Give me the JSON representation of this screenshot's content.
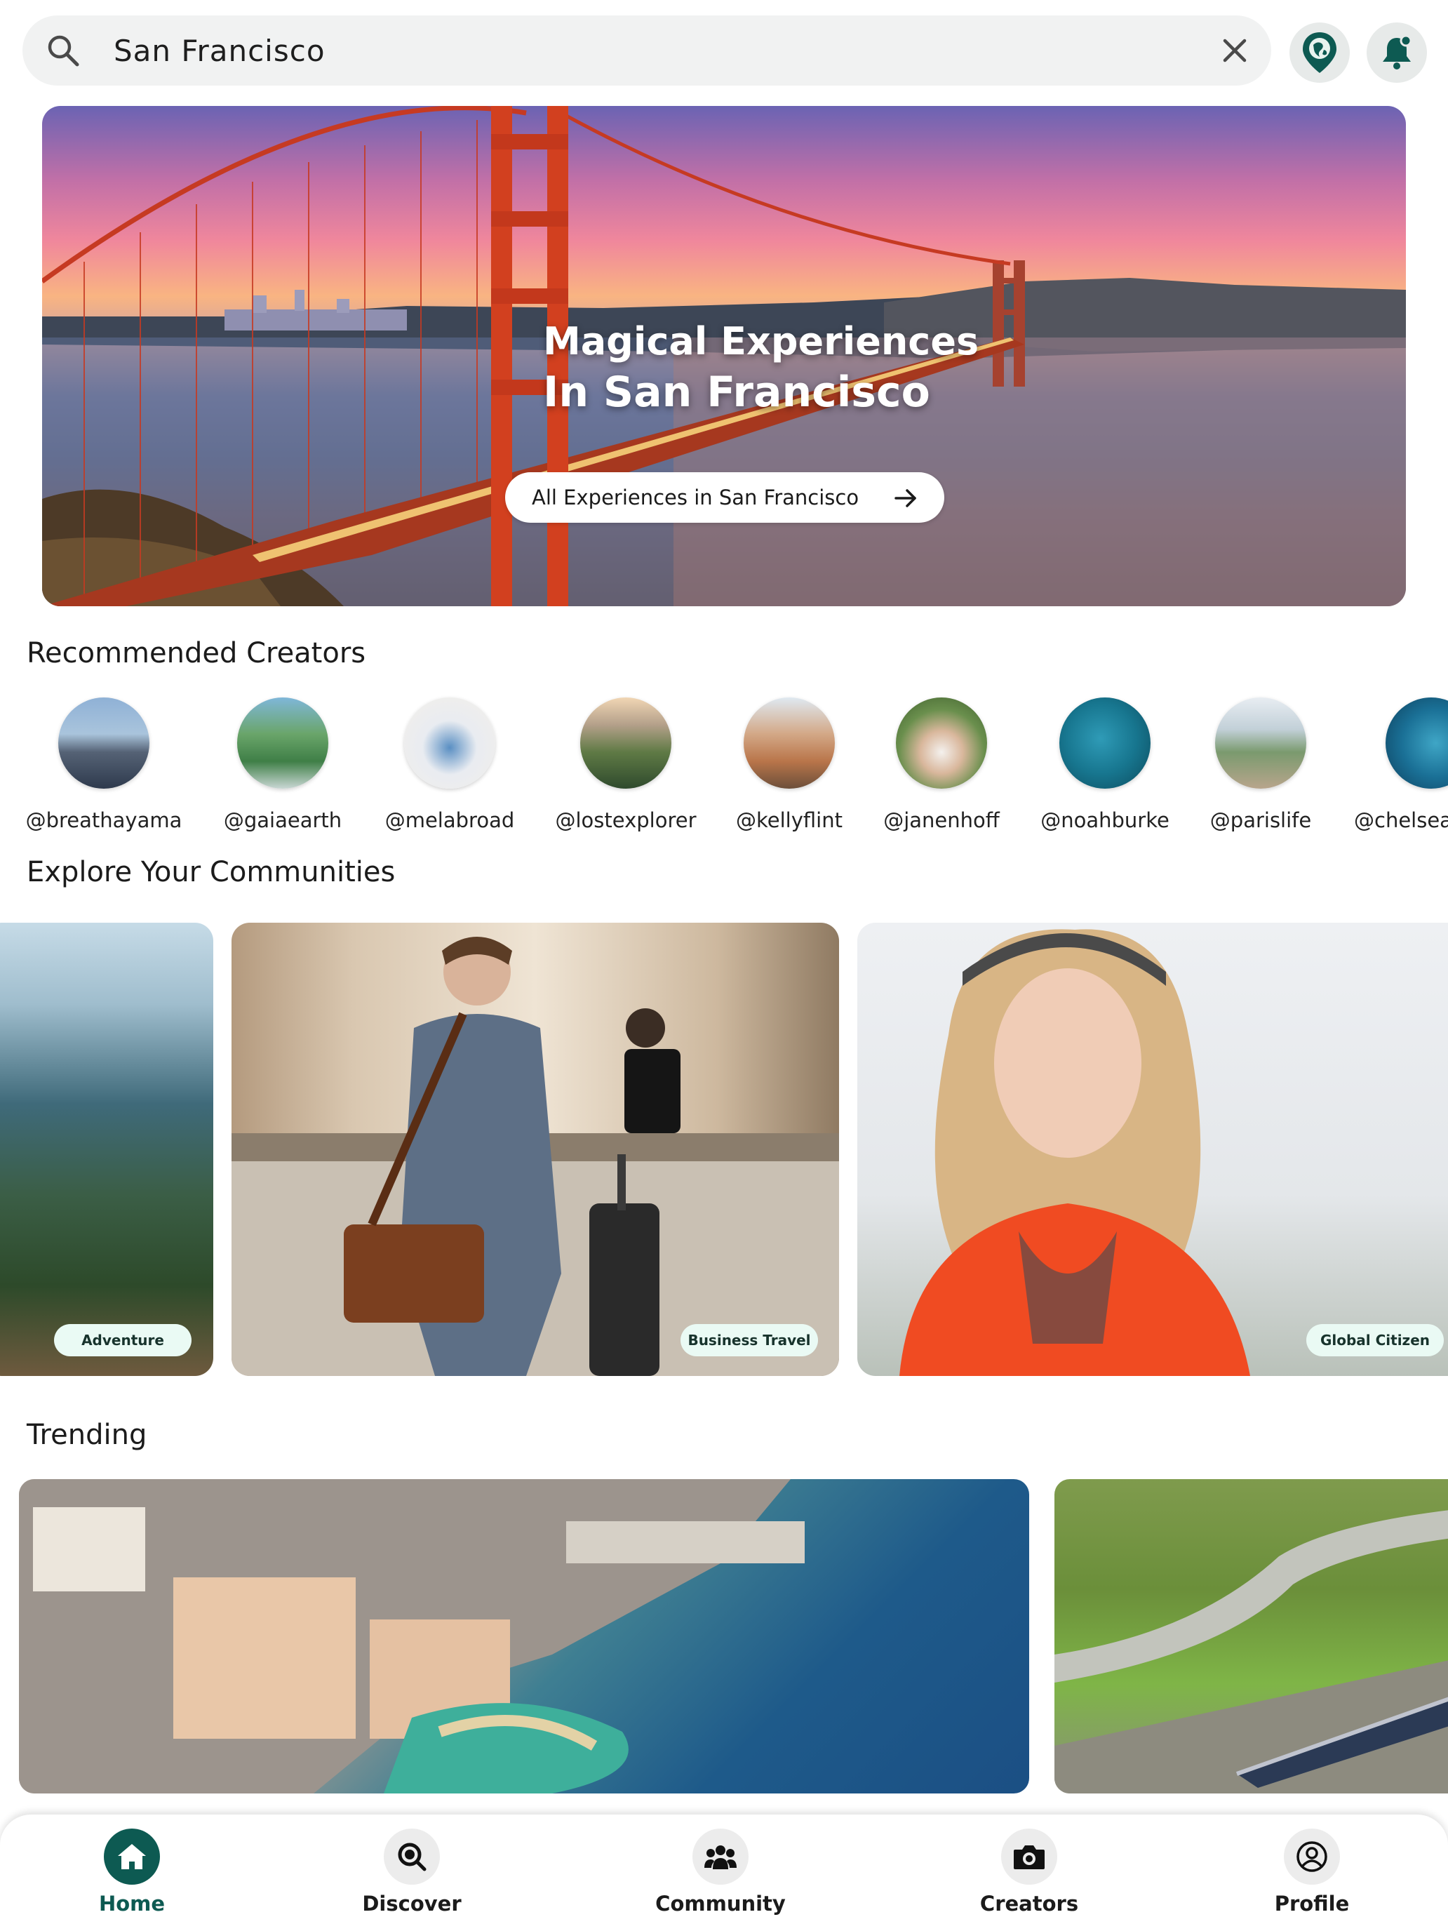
{
  "search": {
    "value": "San Francisco",
    "placeholder": "Search"
  },
  "header": {
    "map_icon": "map-pin-icon",
    "notification_icon": "bell-icon"
  },
  "hero": {
    "title_line1": "Magical Experiences",
    "title_line2": "In San Francisco",
    "cta_label": "All Experiences in San Francisco"
  },
  "sections": {
    "creators_title": "Recommended Creators",
    "communities_title": "Explore Your Communities",
    "trending_title": "Trending"
  },
  "creators": [
    {
      "handle": "@breathayama"
    },
    {
      "handle": "@gaiaearth"
    },
    {
      "handle": "@melabroad"
    },
    {
      "handle": "@lostexplorer"
    },
    {
      "handle": "@kellyflint"
    },
    {
      "handle": "@janenhoff"
    },
    {
      "handle": "@noahburke"
    },
    {
      "handle": "@parislife"
    },
    {
      "handle": "@chelsea"
    }
  ],
  "communities": [
    {
      "label": "Adventure"
    },
    {
      "label": "Business Travel"
    },
    {
      "label": "Global Citizen"
    }
  ],
  "nav": {
    "home": "Home",
    "discover": "Discover",
    "community": "Community",
    "creators": "Creators",
    "profile": "Profile"
  },
  "colors": {
    "accent": "#0d5a52",
    "pill_bg": "#eafaf4",
    "search_bg": "#f1f2f2"
  }
}
